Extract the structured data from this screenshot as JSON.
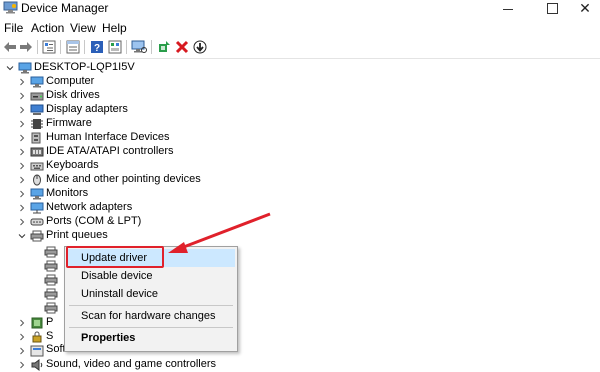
{
  "window": {
    "title": "Device Manager",
    "controls": {
      "minimize": "",
      "maximize": "",
      "close": "✕"
    }
  },
  "menu": [
    "File",
    "Action",
    "View",
    "Help"
  ],
  "toolbar": [
    "back-icon",
    "forward-icon",
    "tree-view-icon",
    "properties-icon",
    "help-icon",
    "resources-icon",
    "scan-hardware-icon",
    "update-driver-icon",
    "uninstall-icon",
    "disable-icon"
  ],
  "tree": {
    "root": "DESKTOP-LQP1I5V",
    "categories": [
      "Computer",
      "Disk drives",
      "Display adapters",
      "Firmware",
      "Human Interface Devices",
      "IDE ATA/ATAPI controllers",
      "Keyboards",
      "Mice and other pointing devices",
      "Monitors",
      "Network adapters",
      "Ports (COM & LPT)",
      "Print queues"
    ],
    "partial_rows": [
      "P",
      "S",
      "Software devices",
      "Sound, video and game controllers"
    ]
  },
  "context_menu": {
    "items": [
      "Update driver",
      "Disable device",
      "Uninstall device",
      "Scan for hardware changes",
      "Properties"
    ],
    "selected": "Update driver"
  },
  "colors": {
    "selection": "#cce8ff",
    "annotation": "#e0212b"
  }
}
